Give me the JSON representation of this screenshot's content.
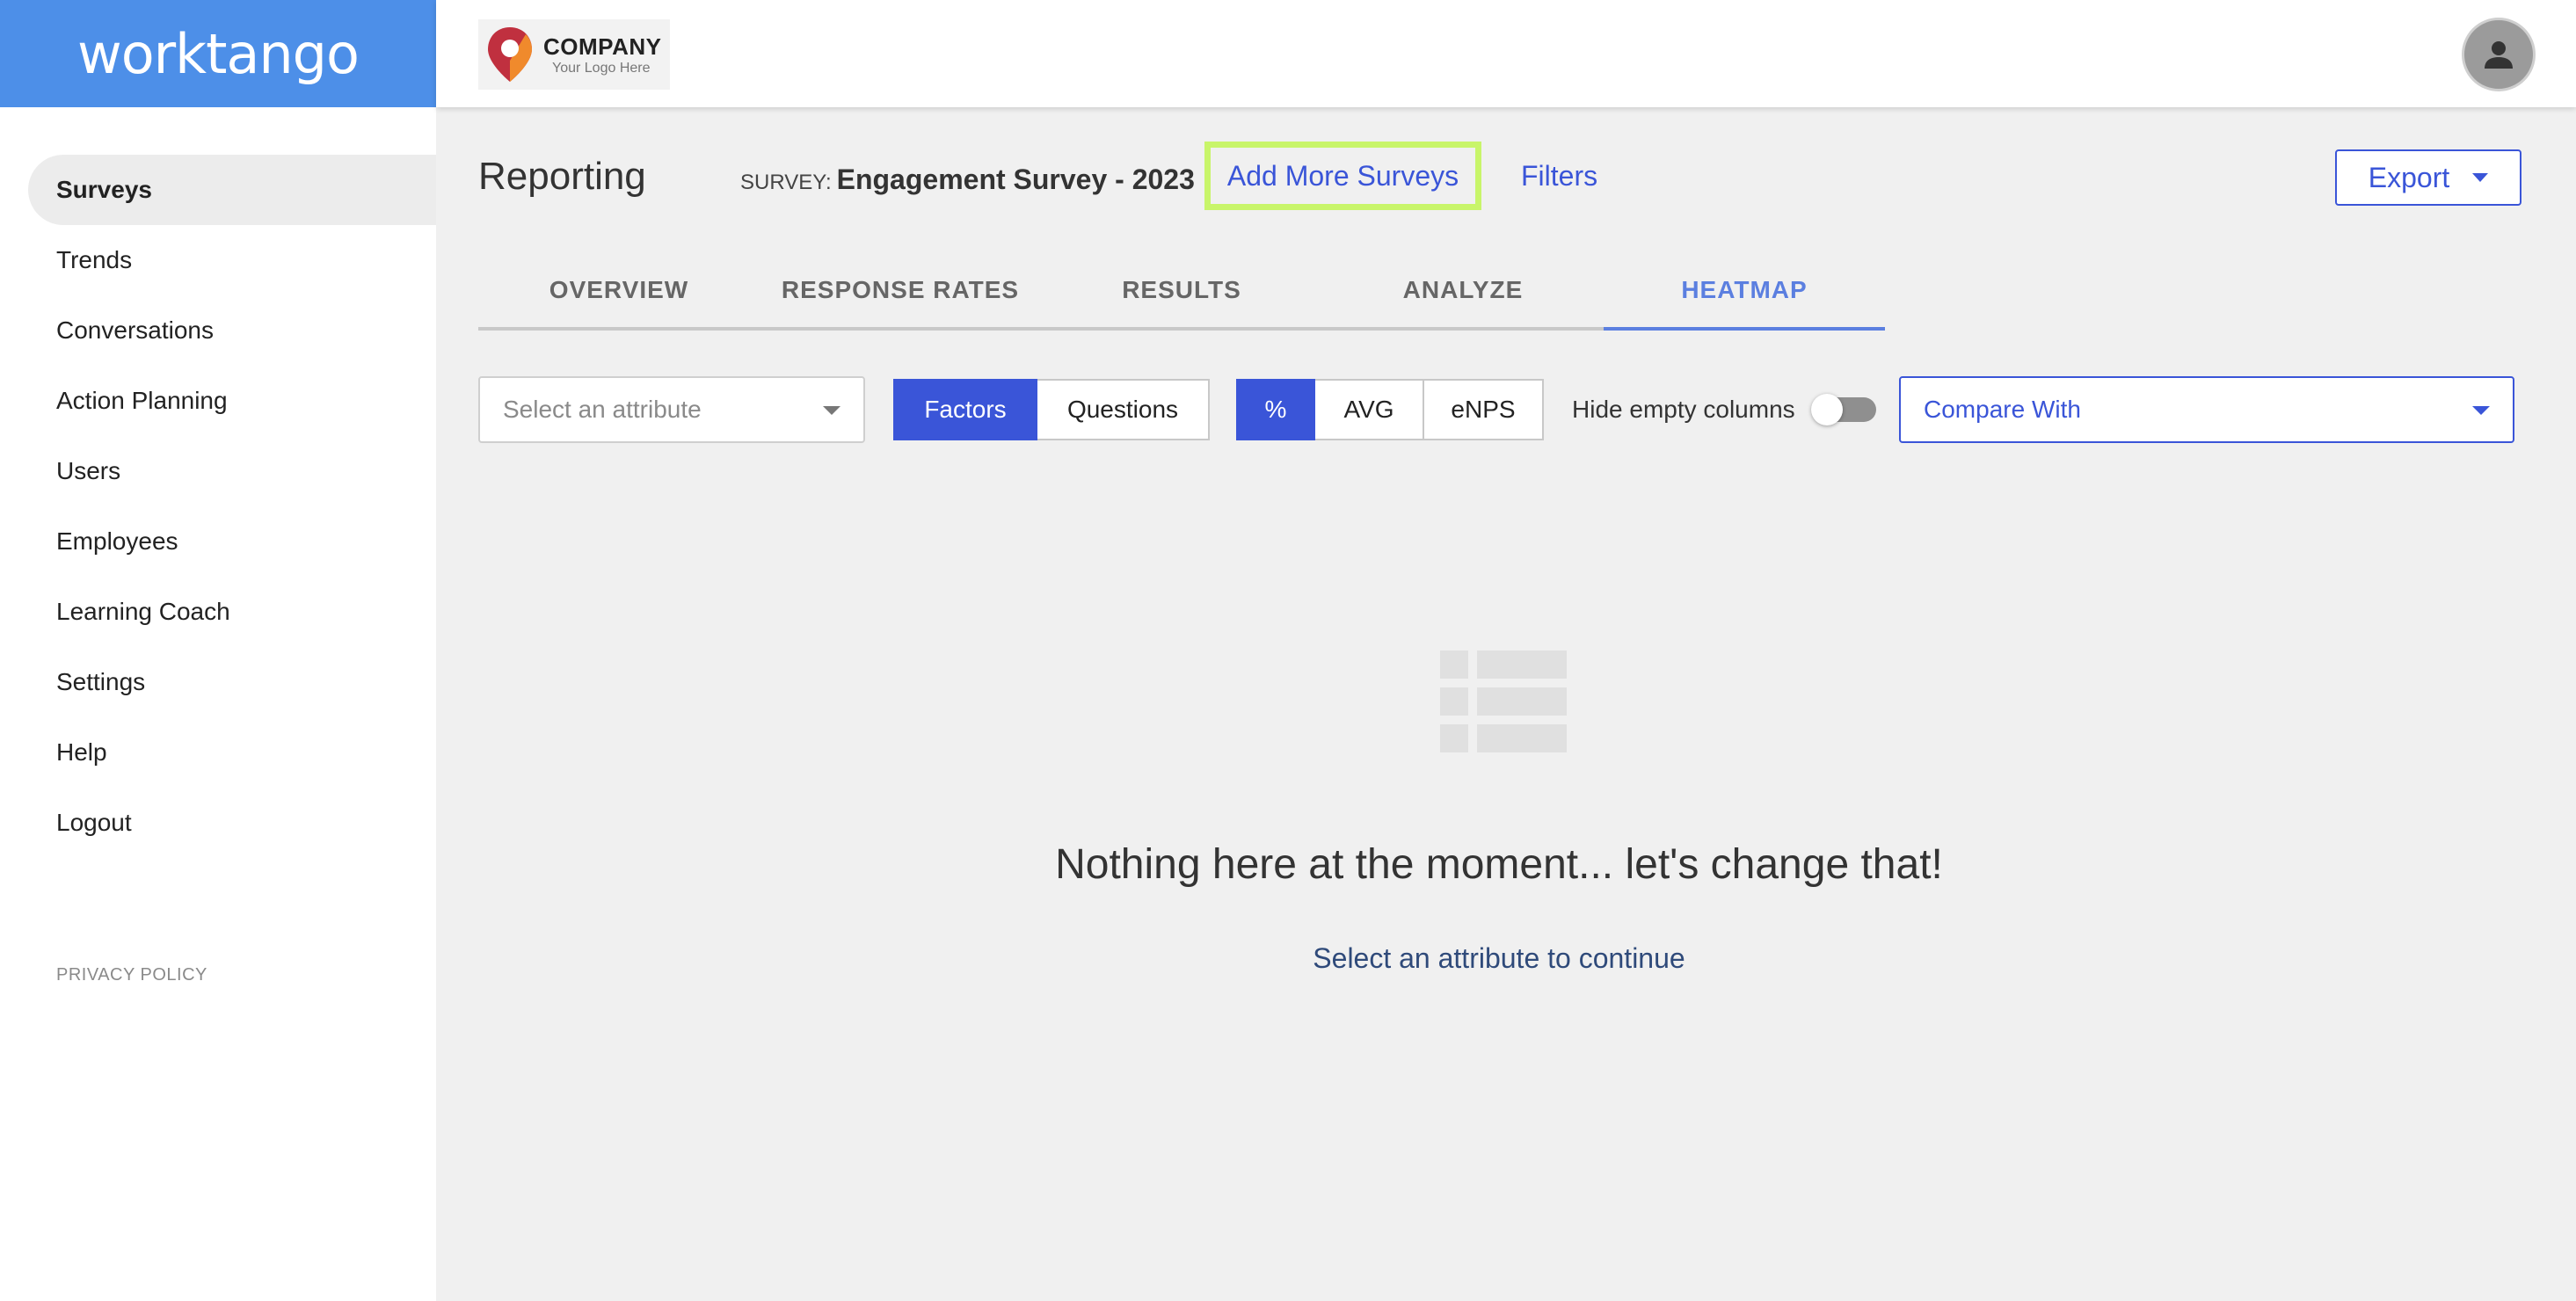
{
  "brand": {
    "name": "worktango"
  },
  "company_logo": {
    "name": "COMPANY",
    "tagline": "Your Logo Here"
  },
  "sidebar": {
    "items": [
      {
        "label": "Surveys",
        "active": true
      },
      {
        "label": "Trends"
      },
      {
        "label": "Conversations"
      },
      {
        "label": "Action Planning"
      },
      {
        "label": "Users"
      },
      {
        "label": "Employees"
      },
      {
        "label": "Learning Coach"
      },
      {
        "label": "Settings"
      },
      {
        "label": "Help"
      },
      {
        "label": "Logout"
      }
    ],
    "privacy": "PRIVACY POLICY"
  },
  "header": {
    "title": "Reporting",
    "survey_label": "SURVEY:",
    "survey_name": "Engagement Survey - 2023",
    "add_surveys": "Add More Surveys",
    "filters": "Filters",
    "export": "Export"
  },
  "tabs": [
    {
      "label": "OVERVIEW"
    },
    {
      "label": "RESPONSE RATES"
    },
    {
      "label": "RESULTS"
    },
    {
      "label": "ANALYZE"
    },
    {
      "label": "HEATMAP",
      "active": true
    }
  ],
  "controls": {
    "attribute_placeholder": "Select an attribute",
    "view_toggle": {
      "factors": "Factors",
      "questions": "Questions",
      "selected": "Factors"
    },
    "metric_toggle": {
      "percent": "%",
      "avg": "AVG",
      "enps": "eNPS",
      "selected": "%"
    },
    "hide_empty_label": "Hide empty columns",
    "hide_empty_on": false,
    "compare_with": "Compare With"
  },
  "empty_state": {
    "title": "Nothing here at the moment... let's change that!",
    "subtitle": "Select an attribute to continue",
    "icon": "table-placeholder-icon"
  },
  "colors": {
    "brand": "#4d8fe8",
    "accent": "#3a55d8",
    "active_tab": "#5b7fe0",
    "highlight": "#c8f56a"
  }
}
